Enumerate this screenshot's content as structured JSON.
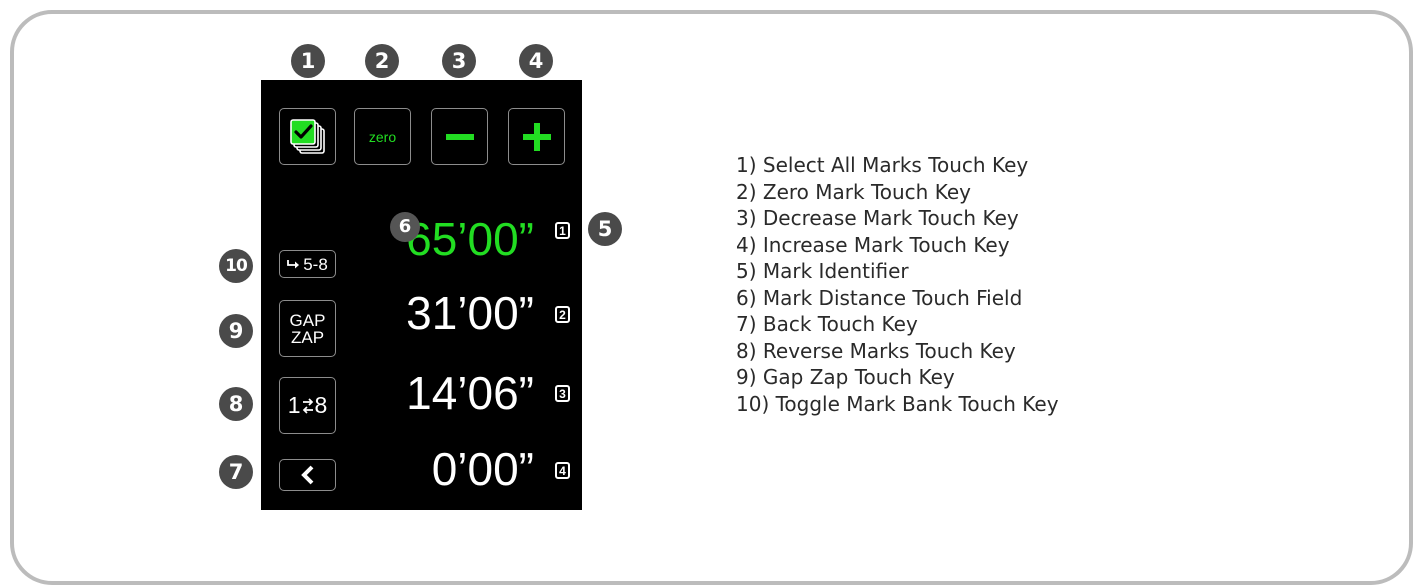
{
  "callouts": [
    "1",
    "2",
    "3",
    "4",
    "5",
    "6",
    "7",
    "8",
    "9",
    "10"
  ],
  "top_keys": {
    "select_all_icon": "select-all-marks-icon",
    "zero_label": "zero",
    "decrease_icon": "minus-icon",
    "increase_icon": "plus-icon"
  },
  "side_keys": {
    "toggle_bank_label": "5-8",
    "toggle_bank_icon": "arrow-right-icon",
    "gap_zap_line1": "GAP",
    "gap_zap_line2": "ZAP",
    "reverse_left": "1",
    "reverse_right": "8",
    "reverse_icon": "swap-arrows-icon",
    "back_icon": "chevron-left-icon"
  },
  "marks": [
    {
      "value": "65’00”",
      "id": "1",
      "selected": true
    },
    {
      "value": "31’00”",
      "id": "2",
      "selected": false
    },
    {
      "value": "14’06”",
      "id": "3",
      "selected": false
    },
    {
      "value": "0’00”",
      "id": "4",
      "selected": false
    }
  ],
  "legend": [
    "1) Select All Marks Touch Key",
    "2) Zero Mark Touch Key",
    "3) Decrease Mark Touch Key",
    "4) Increase Mark Touch Key",
    "5) Mark Identifier",
    "6) Mark Distance Touch Field",
    "7) Back Touch Key",
    "8) Reverse Marks Touch Key",
    "9) Gap Zap Touch Key",
    "10) Toggle Mark Bank Touch Key"
  ],
  "colors": {
    "accent_green": "#22dd22",
    "screen_background": "#000000",
    "callout_background": "#4a4a4a",
    "frame_border": "#bcbcbc"
  }
}
